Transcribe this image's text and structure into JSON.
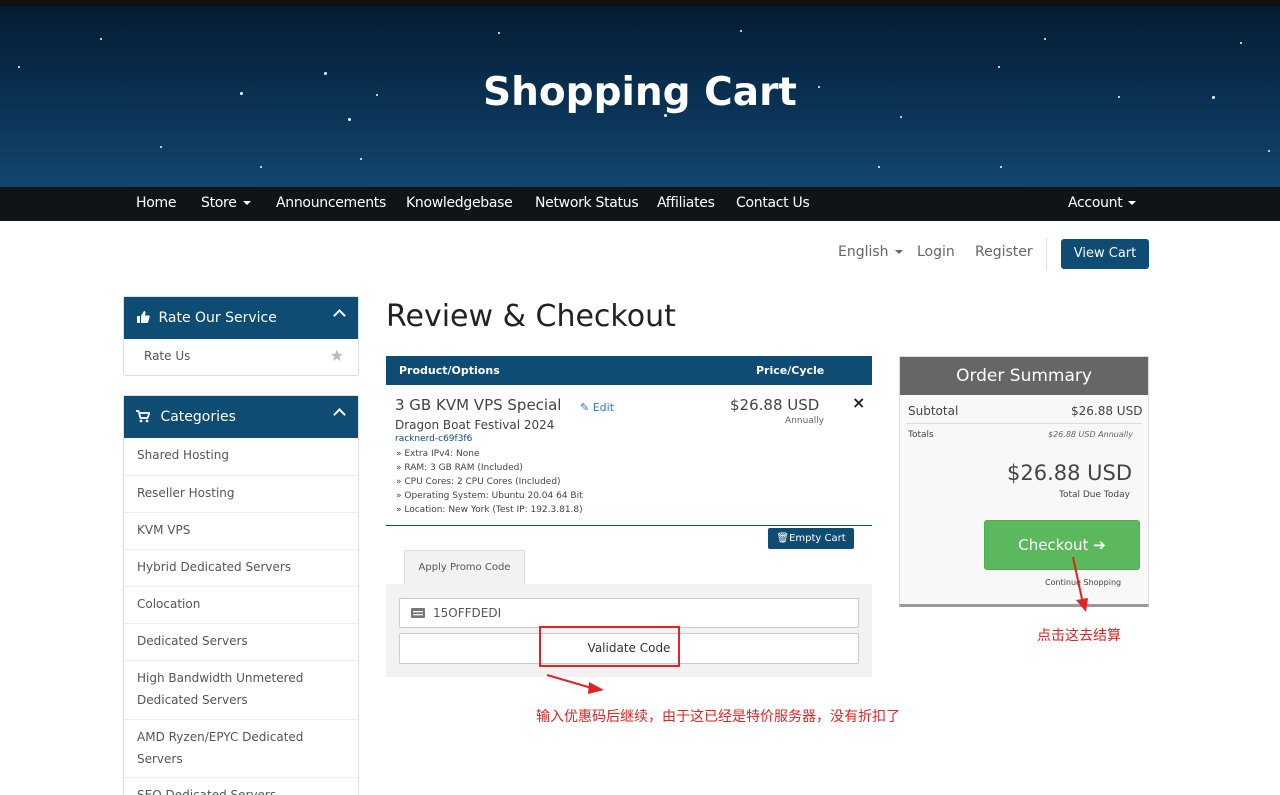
{
  "hero": {
    "title": "Shopping Cart"
  },
  "nav": {
    "items": [
      "Home",
      "Store",
      "Announcements",
      "Knowledgebase",
      "Network Status",
      "Affiliates",
      "Contact Us"
    ],
    "account": "Account"
  },
  "utility": {
    "language": "English",
    "login": "Login",
    "register": "Register",
    "view_cart": "View Cart"
  },
  "sidebar": {
    "rate_panel": {
      "title": "Rate Our Service",
      "item": "Rate Us"
    },
    "categories_panel": {
      "title": "Categories",
      "items": [
        "Shared Hosting",
        "Reseller Hosting",
        "KVM VPS",
        "Hybrid Dedicated Servers",
        "Colocation",
        "Dedicated Servers",
        "High Bandwidth Unmetered Dedicated Servers",
        "AMD Ryzen/EPYC Dedicated Servers",
        "SEO Dedicated Servers"
      ]
    }
  },
  "main": {
    "title": "Review & Checkout",
    "table_headers": {
      "product": "Product/Options",
      "price": "Price/Cycle"
    },
    "product": {
      "name": "3 GB KVM VPS Special",
      "edit": "Edit",
      "group": "Dragon Boat Festival 2024",
      "hostname": "racknerd-c69f3f6",
      "options": [
        "» Extra IPv4: None",
        "» RAM: 3 GB RAM (Included)",
        "» CPU Cores: 2 CPU Cores (Included)",
        "» Operating System: Ubuntu 20.04 64 Bit",
        "» Location: New York (Test IP: 192.3.81.8)"
      ],
      "price": "$26.88 USD",
      "cycle": "Annually",
      "remove": "×"
    },
    "empty_cart": "Empty Cart",
    "promo": {
      "tab": "Apply Promo Code",
      "code": "15OFFDEDI",
      "validate": "Validate Code"
    }
  },
  "summary": {
    "title": "Order Summary",
    "subtotal_label": "Subtotal",
    "subtotal_value": "$26.88 USD",
    "totals_label": "Totals",
    "totals_value": "$26.88 USD Annually",
    "total_due": "$26.88 USD",
    "total_due_label": "Total Due Today",
    "checkout": "Checkout",
    "continue": "Continue Shopping"
  },
  "annotations": {
    "checkout_note": "点击这去结算",
    "promo_note": "输入优惠码后继续，由于这已经是特价服务器，没有折扣了",
    "color": "#e02424"
  },
  "colors": {
    "brand": "#0f4c73",
    "checkout": "#5cb85c",
    "nav_bg": "#0f1419"
  }
}
